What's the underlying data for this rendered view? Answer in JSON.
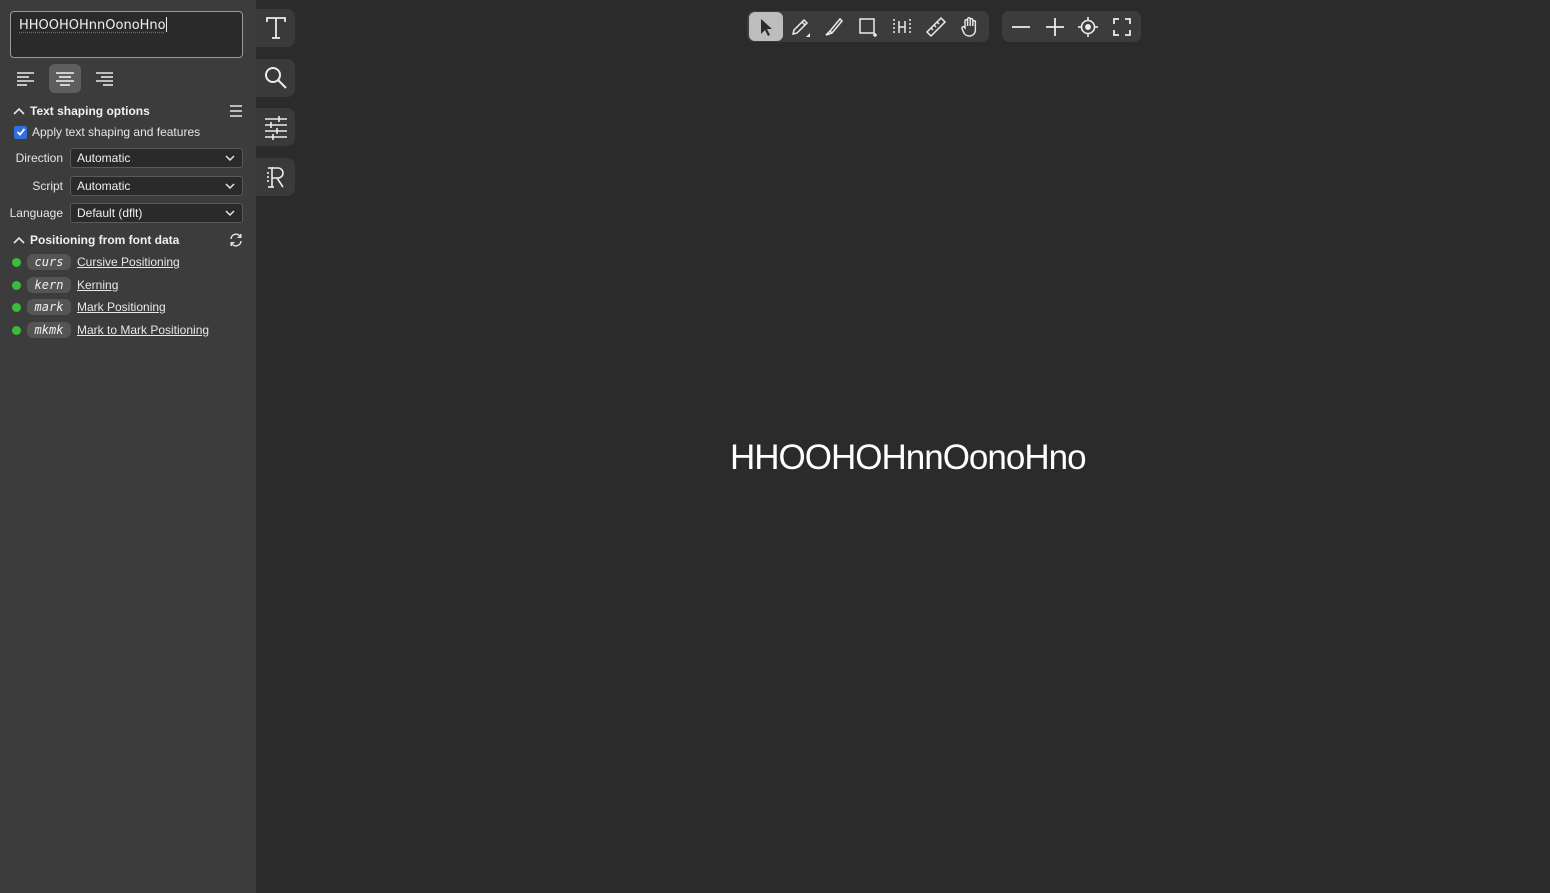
{
  "text_input": {
    "value": "HHOOHOHnnOonoHno"
  },
  "alignment": {
    "options": [
      {
        "name": "align-left",
        "icon": "align-left-icon",
        "active": false
      },
      {
        "name": "align-center",
        "icon": "align-center-icon",
        "active": true
      },
      {
        "name": "align-right",
        "icon": "align-right-icon",
        "active": false
      }
    ]
  },
  "shaping": {
    "title": "Text shaping options",
    "apply_label": "Apply text shaping and features",
    "apply_checked": true,
    "direction_label": "Direction",
    "direction_value": "Automatic",
    "script_label": "Script",
    "script_value": "Automatic",
    "language_label": "Language",
    "language_value": "Default (dflt)"
  },
  "positioning": {
    "title": "Positioning from font data",
    "features": [
      {
        "tag": "curs",
        "label": "Cursive Positioning",
        "enabled": true
      },
      {
        "tag": "kern",
        "label": "Kerning",
        "enabled": true
      },
      {
        "tag": "mark",
        "label": "Mark Positioning",
        "enabled": true
      },
      {
        "tag": "mkmk",
        "label": "Mark to Mark Positioning",
        "enabled": true
      }
    ]
  },
  "side_tools": [
    "text-tool-icon",
    "search-icon",
    "sliders-icon",
    "reference-font-icon"
  ],
  "toolbar": {
    "tools": [
      "pointer-icon",
      "pen-icon",
      "knife-icon",
      "rectangle-icon",
      "sidebearings-icon",
      "ruler-icon",
      "hand-icon"
    ],
    "active_tool": "pointer-icon",
    "view": [
      "zoom-out-icon",
      "zoom-in-icon",
      "zoom-fit-icon",
      "fullscreen-icon"
    ]
  },
  "canvas": {
    "text": "HHOOHOHnnOonoHno"
  },
  "colors": {
    "panel": "#3c3c3c",
    "canvas": "#2b2b2b",
    "enabled_dot": "#3dbb3d",
    "checkbox": "#2f6fdf"
  }
}
